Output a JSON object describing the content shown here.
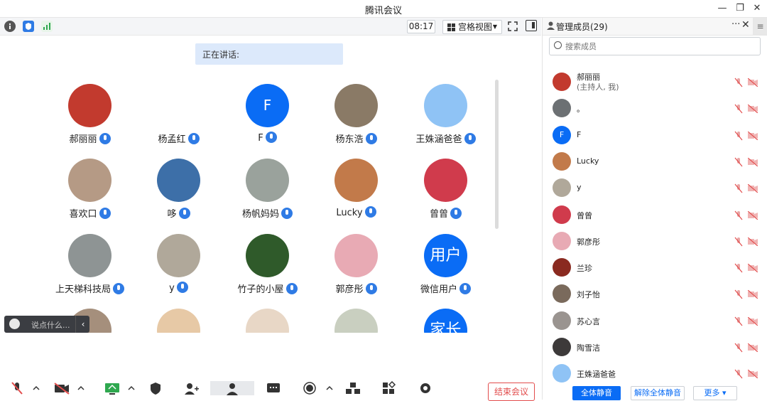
{
  "window": {
    "title": "腾讯会议",
    "minimize": "—",
    "maximize": "❐",
    "close": "✕"
  },
  "statusbar": {
    "time": "08:17",
    "view_label": "宫格视图"
  },
  "speaking_label": "正在讲话:",
  "tiles": [
    {
      "name": "郝丽丽",
      "color": "#c23a2e"
    },
    {
      "name": "杨孟红",
      "color": "#ffffff"
    },
    {
      "name": "F",
      "letter": "F",
      "color": "#0a6cf5"
    },
    {
      "name": "杨东浩",
      "color": "#8a7a66"
    },
    {
      "name": "王姝涵爸爸",
      "color": "#8fc3f5"
    },
    {
      "name": "喜欢口",
      "color": "#b59a85"
    },
    {
      "name": "哆",
      "color": "#3d6fa8"
    },
    {
      "name": "杨帆妈妈",
      "color": "#9aa29c"
    },
    {
      "name": "Lucky",
      "color": "#c27a4a"
    },
    {
      "name": "曾曾",
      "color": "#d03b4c"
    },
    {
      "name": "上天梯科技局",
      "color": "#8e9494"
    },
    {
      "name": "y",
      "color": "#b0a89a"
    },
    {
      "name": "竹子的小屋",
      "color": "#2f5a2a"
    },
    {
      "name": "郭彦彤",
      "color": "#e8aab4"
    },
    {
      "name": "微信用户",
      "letter": "用户",
      "color": "#0a6cf5"
    },
    {
      "name": "",
      "color": "#a58f7c"
    },
    {
      "name": "",
      "color": "#e7c9a6"
    },
    {
      "name": "",
      "color": "#e8d7c6"
    },
    {
      "name": "",
      "color": "#c9cfc0"
    },
    {
      "name": "",
      "letter": "家长",
      "color": "#0a6cf5"
    }
  ],
  "chat": {
    "placeholder": "说点什么...",
    "arrow": "‹"
  },
  "end_meeting": "结束会议",
  "panel": {
    "title": "管理成员(29)",
    "more": "···",
    "close": "✕",
    "menu": "≡",
    "search_placeholder": "搜索成员",
    "members": [
      {
        "name": "郝丽丽",
        "sub": "(主持人, 我)",
        "color": "#c23a2e"
      },
      {
        "name": "。",
        "color": "#6c7073"
      },
      {
        "name": "F",
        "letter": "F",
        "color": "#0a6cf5"
      },
      {
        "name": "Lucky",
        "color": "#c27a4a"
      },
      {
        "name": "y",
        "color": "#b0a89a"
      },
      {
        "name": "曾曾",
        "color": "#d03b4c"
      },
      {
        "name": "郭彦彤",
        "color": "#e8aab4"
      },
      {
        "name": "兰珍",
        "color": "#8a2a20"
      },
      {
        "name": "刘子怡",
        "color": "#7a6a5c"
      },
      {
        "name": "苏心言",
        "color": "#9a9490"
      },
      {
        "name": "陶雪洁",
        "color": "#3d3a3a"
      },
      {
        "name": "王姝涵爸爸",
        "color": "#8fc3f5"
      }
    ],
    "mute_all": "全体静音",
    "unmute_all": "解除全体静音",
    "more_btn": "更多 ▾"
  }
}
